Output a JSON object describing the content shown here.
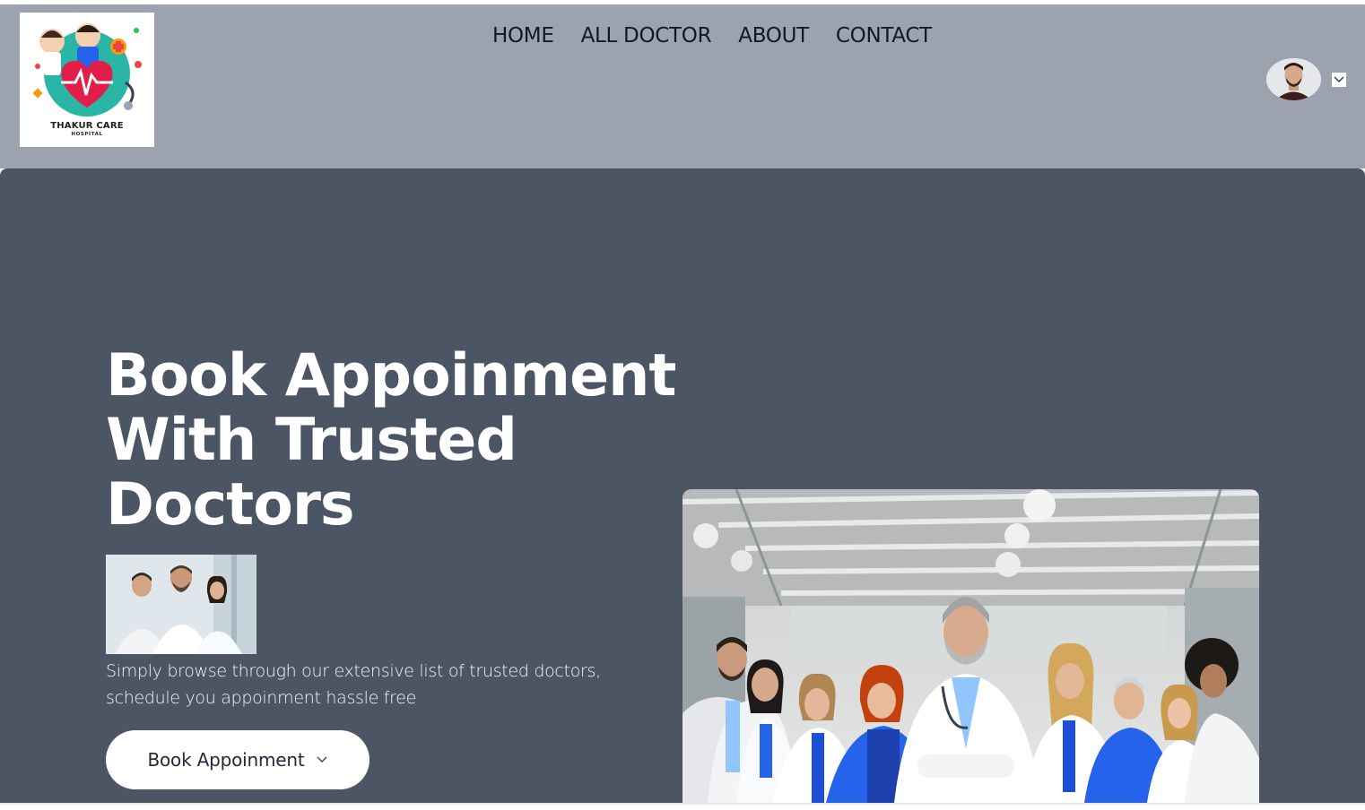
{
  "logo": {
    "name_line1": "THAKUR CARE",
    "name_line2": "HOSPITAL",
    "icon": "hospital-heart-logo-icon"
  },
  "nav": {
    "items": [
      {
        "label": "HOME"
      },
      {
        "label": "ALL DOCTOR"
      },
      {
        "label": "ABOUT"
      },
      {
        "label": "CONTACT"
      }
    ]
  },
  "profile": {
    "avatar_icon": "user-avatar",
    "dropdown_icon": "chevron-down-icon"
  },
  "hero": {
    "title_line1": "Book Appoinment",
    "title_line2": "With Trusted",
    "title_line3": "Doctors",
    "description_line1": "Simply browse through our extensive list of trusted doctors,",
    "description_line2": "schedule you appoinment hassle free",
    "button_label": "Book Appoinment",
    "button_icon": "chevron-down-icon"
  },
  "colors": {
    "navbar_bg": "#9ca3af",
    "hero_bg": "#4b5563",
    "text_dark": "#111827",
    "button_bg": "#ffffff"
  }
}
